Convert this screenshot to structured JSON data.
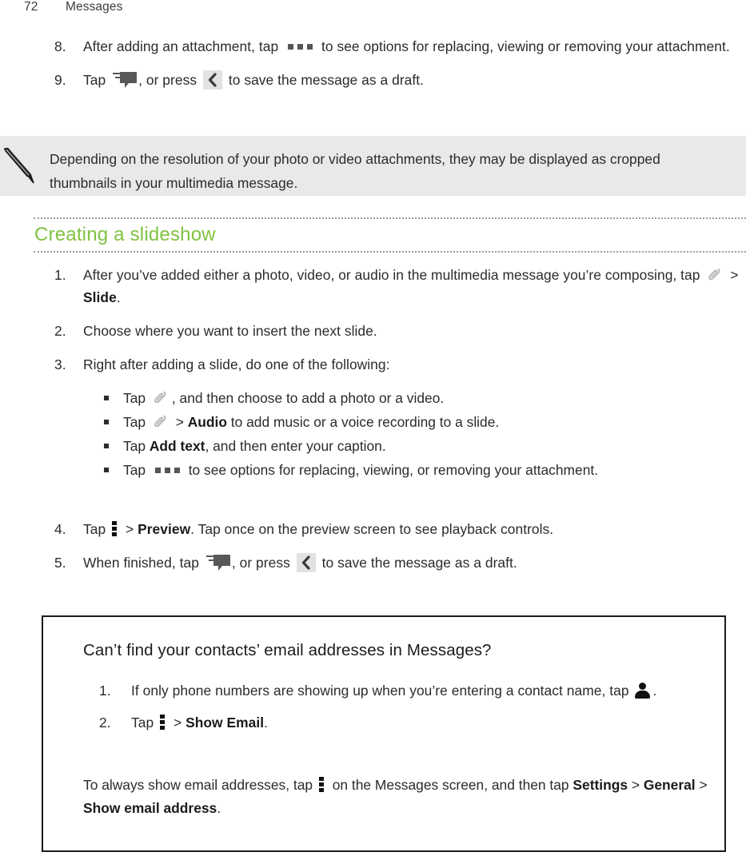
{
  "header": {
    "page_number": "72",
    "chapter": "Messages"
  },
  "colors": {
    "heading_green": "#80c342",
    "note_background": "#e9e9e9",
    "body_text": "#2b2b2b",
    "icon_dark": "#585858"
  },
  "top_steps": [
    {
      "num": "8.",
      "parts": [
        {
          "t": "text",
          "v": "After adding an attachment, tap "
        },
        {
          "t": "icon",
          "v": "more-options-horizontal-icon"
        },
        {
          "t": "text",
          "v": " to see options for replacing, viewing or removing your attachment."
        }
      ]
    },
    {
      "num": "9.",
      "parts": [
        {
          "t": "text",
          "v": "Tap "
        },
        {
          "t": "icon",
          "v": "send-message-icon"
        },
        {
          "t": "text",
          "v": ", or press "
        },
        {
          "t": "icon",
          "v": "back-icon"
        },
        {
          "t": "text",
          "v": " to save the message as a draft."
        }
      ]
    }
  ],
  "note": {
    "icon": "pencil-icon",
    "text": "Depending on the resolution of your photo or video attachments, they may be displayed as cropped thumbnails in your multimedia message."
  },
  "section": {
    "title": "Creating a slideshow"
  },
  "slideshow_steps": [
    {
      "num": "1.",
      "text_before": "After you’ve added either a photo, video, or audio in the multimedia message you’re composing, tap ",
      "icon": "paperclip-icon",
      "mid": " > ",
      "bold": "Slide",
      "text_after": "."
    },
    {
      "num": "2.",
      "text_before": "Choose where you want to insert the next slide.",
      "icon": "",
      "mid": "",
      "bold": "",
      "text_after": ""
    },
    {
      "num": "3.",
      "text_before": "Right after adding a slide, do one of the following:",
      "icon": "",
      "mid": "",
      "bold": "",
      "text_after": ""
    }
  ],
  "slideshow_bullets": [
    {
      "text_before": "Tap ",
      "icon": "paperclip-icon",
      "mid": ", and then choose to add a photo or a video.",
      "bold": "",
      "text_after": ""
    },
    {
      "text_before": "Tap ",
      "icon": "paperclip-icon",
      "mid": " > ",
      "bold": "Audio",
      "text_after": " to add music or a voice recording to a slide."
    },
    {
      "text_before": "Tap ",
      "icon": "",
      "mid": "",
      "bold": "Add text",
      "text_after": ", and then enter your caption."
    },
    {
      "text_before": "Tap ",
      "icon": "more-options-horizontal-icon",
      "mid": " to see options for replacing, viewing, or removing your attachment.",
      "bold": "",
      "text_after": ""
    }
  ],
  "slideshow_steps_tail": [
    {
      "num": "4.",
      "text_before": "Tap ",
      "icon": "overflow-menu-icon",
      "mid": " > ",
      "bold": "Preview",
      "text_after": ". Tap once on the preview screen to see playback controls."
    },
    {
      "num": "5.",
      "text_before": "When finished, tap ",
      "icon": "send-message-icon",
      "mid": ", or press ",
      "icon2": "back-icon",
      "text_after": " to save the message as a draft."
    }
  ],
  "tipbox": {
    "title": "Can’t find your contacts’ email addresses in Messages?",
    "steps": [
      {
        "num": "1.",
        "text_before": "If only phone numbers are showing up when you’re entering a contact name, tap ",
        "icon": "person-icon",
        "text_after": "."
      },
      {
        "num": "2.",
        "text_before": "Tap ",
        "icon": "overflow-menu-icon",
        "mid": " > ",
        "bold": "Show Email",
        "text_after": "."
      }
    ],
    "footer": {
      "text_before": "To always show email addresses, tap ",
      "icon": "overflow-menu-icon",
      "text_mid": " on the Messages screen, and then tap ",
      "bold1": "Settings",
      "sep1": " > ",
      "bold2": "General",
      "sep2": " > ",
      "bold3": "Show email address",
      "text_after": "."
    }
  }
}
